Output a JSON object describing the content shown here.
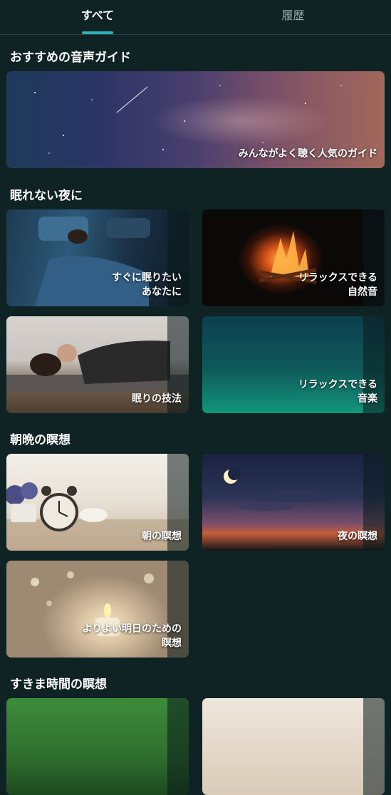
{
  "tabs": {
    "all": "すべて",
    "history": "履歴"
  },
  "sections": {
    "recommended": {
      "title": "おすすめの音声ガイド",
      "banner_label": "みんながよく聴く人気のガイド"
    },
    "sleepless": {
      "title": "眠れない夜に",
      "cards": [
        {
          "label_line1": "すぐに眠りたい",
          "label_line2": "あなたに"
        },
        {
          "label_line1": "リラックスできる",
          "label_line2": "自然音"
        },
        {
          "label_line1": "眠りの技法"
        },
        {
          "label_line1": "リラックスできる",
          "label_line2": "音楽"
        }
      ]
    },
    "morning_evening": {
      "title": "朝晩の瞑想",
      "cards": [
        {
          "label_line1": "朝の瞑想"
        },
        {
          "label_line1": "夜の瞑想"
        },
        {
          "label_line1": "よりよい明日のための",
          "label_line2": "瞑想"
        }
      ]
    },
    "short": {
      "title": "すきま時間の瞑想"
    }
  },
  "colors": {
    "background": "#0f2325",
    "accent": "#28b3b5",
    "inactive_tab": "#9aa9ab"
  }
}
